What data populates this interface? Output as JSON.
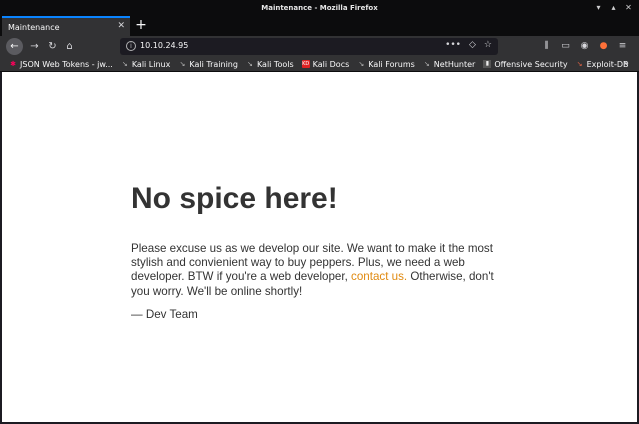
{
  "window": {
    "title": "Maintenance - Mozilla Firefox",
    "controls": {
      "minimize": "▾",
      "maximize": "▴",
      "close": "✕"
    }
  },
  "tabs": [
    {
      "label": "Maintenance",
      "close": "✕"
    }
  ],
  "newtab": "+",
  "nav": {
    "back": "←",
    "forward": "→",
    "reload": "↻",
    "home": "⌂",
    "url_info": "i",
    "url": "10.10.24.95",
    "page_actions": "•••",
    "pocket": "◇",
    "star": "☆",
    "library": "⫼",
    "sidebar": "▭",
    "account": "◉",
    "firefox": "●",
    "menu": "≡"
  },
  "bookmarks": [
    {
      "label": "JSON Web Tokens - jw...",
      "icon": "jwt-icon",
      "glyph": "✱"
    },
    {
      "label": "Kali Linux",
      "icon": "kali-icon",
      "glyph": "↘"
    },
    {
      "label": "Kali Training",
      "icon": "kali-icon",
      "glyph": "↘"
    },
    {
      "label": "Kali Tools",
      "icon": "kali-icon",
      "glyph": "↘"
    },
    {
      "label": "Kali Docs",
      "icon": "kali-docs-icon",
      "glyph": "KD"
    },
    {
      "label": "Kali Forums",
      "icon": "kali-icon",
      "glyph": "↘"
    },
    {
      "label": "NetHunter",
      "icon": "kali-icon",
      "glyph": "↘"
    },
    {
      "label": "Offensive Security",
      "icon": "offsec-icon",
      "glyph": "▮"
    },
    {
      "label": "Exploit-DB",
      "icon": "exploitdb-icon",
      "glyph": "↘"
    }
  ],
  "bookmarks_more": "»",
  "page": {
    "heading": "No spice here!",
    "paragraph_before_link": "Please excuse us as we develop our site. We want to make it the most stylish and convienient way to buy peppers. Plus, we need a web developer. BTW if you're a web developer, ",
    "link_text": "contact us.",
    "paragraph_after_link": " Otherwise, don't you worry. We'll be online shortly!",
    "signature": "— Dev Team"
  },
  "colors": {
    "accent_tab": "#0a84ff",
    "link": "#e08a10",
    "text": "#333333",
    "chrome": "#323234"
  }
}
